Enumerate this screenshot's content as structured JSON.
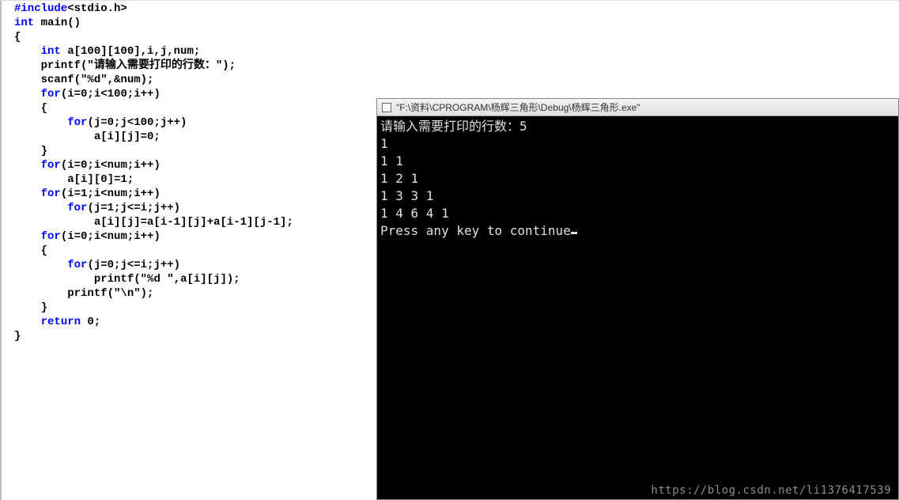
{
  "code": {
    "tokens": [
      [
        {
          "t": "#include",
          "c": "pp"
        },
        {
          "t": "<stdio.h>",
          "c": "inc"
        }
      ],
      [
        {
          "t": "int ",
          "c": "kw"
        },
        {
          "t": "main()",
          "c": ""
        }
      ],
      [
        {
          "t": "{",
          "c": ""
        }
      ],
      [
        {
          "t": "    ",
          "c": ""
        },
        {
          "t": "int ",
          "c": "kw"
        },
        {
          "t": "a[100][100],i,j,num;",
          "c": ""
        }
      ],
      [
        {
          "t": "    printf(",
          "c": ""
        },
        {
          "t": "\"请输入需要打印的行数：\"",
          "c": "str"
        },
        {
          "t": ");",
          "c": ""
        }
      ],
      [
        {
          "t": "    scanf(",
          "c": ""
        },
        {
          "t": "\"%d\"",
          "c": "str"
        },
        {
          "t": ",&num);",
          "c": ""
        }
      ],
      [
        {
          "t": "    ",
          "c": ""
        },
        {
          "t": "for",
          "c": "kw"
        },
        {
          "t": "(i=0;i<100;i++)",
          "c": ""
        }
      ],
      [
        {
          "t": "    {",
          "c": ""
        }
      ],
      [
        {
          "t": "        ",
          "c": ""
        },
        {
          "t": "for",
          "c": "kw"
        },
        {
          "t": "(j=0;j<100;j++)",
          "c": ""
        }
      ],
      [
        {
          "t": "            a[i][j]=0;",
          "c": ""
        }
      ],
      [
        {
          "t": "    }",
          "c": ""
        }
      ],
      [
        {
          "t": "    ",
          "c": ""
        },
        {
          "t": "for",
          "c": "kw"
        },
        {
          "t": "(i=0;i<num;i++)",
          "c": ""
        }
      ],
      [
        {
          "t": "        a[i][0]=1;",
          "c": ""
        }
      ],
      [
        {
          "t": "    ",
          "c": ""
        },
        {
          "t": "for",
          "c": "kw"
        },
        {
          "t": "(i=1;i<num;i++)",
          "c": ""
        }
      ],
      [
        {
          "t": "        ",
          "c": ""
        },
        {
          "t": "for",
          "c": "kw"
        },
        {
          "t": "(j=1;j<=i;j++)",
          "c": ""
        }
      ],
      [
        {
          "t": "            a[i][j]=a[i-1][j]+a[i-1][j-1];",
          "c": ""
        }
      ],
      [
        {
          "t": "    ",
          "c": ""
        },
        {
          "t": "for",
          "c": "kw"
        },
        {
          "t": "(i=0;i<num;i++)",
          "c": ""
        }
      ],
      [
        {
          "t": "    {",
          "c": ""
        }
      ],
      [
        {
          "t": "        ",
          "c": ""
        },
        {
          "t": "for",
          "c": "kw"
        },
        {
          "t": "(j=0;j<=i;j++)",
          "c": ""
        }
      ],
      [
        {
          "t": "            printf(",
          "c": ""
        },
        {
          "t": "\"%d \"",
          "c": "str"
        },
        {
          "t": ",a[i][j]);",
          "c": ""
        }
      ],
      [
        {
          "t": "        printf(",
          "c": ""
        },
        {
          "t": "\"\\n\"",
          "c": "str"
        },
        {
          "t": ");",
          "c": ""
        }
      ],
      [
        {
          "t": "    }",
          "c": ""
        }
      ],
      [
        {
          "t": "    ",
          "c": ""
        },
        {
          "t": "return ",
          "c": "kw"
        },
        {
          "t": "0;",
          "c": ""
        }
      ],
      [
        {
          "t": "}",
          "c": ""
        }
      ]
    ]
  },
  "console": {
    "title": "\"F:\\资料\\CPROGRAM\\杨辉三角形\\Debug\\杨辉三角形.exe\"",
    "lines": [
      "请输入需要打印的行数：5",
      "1",
      "1 1",
      "1 2 1",
      "1 3 3 1",
      "1 4 6 4 1",
      "Press any key to continue"
    ]
  },
  "watermark": "https://blog.csdn.net/li1376417539"
}
